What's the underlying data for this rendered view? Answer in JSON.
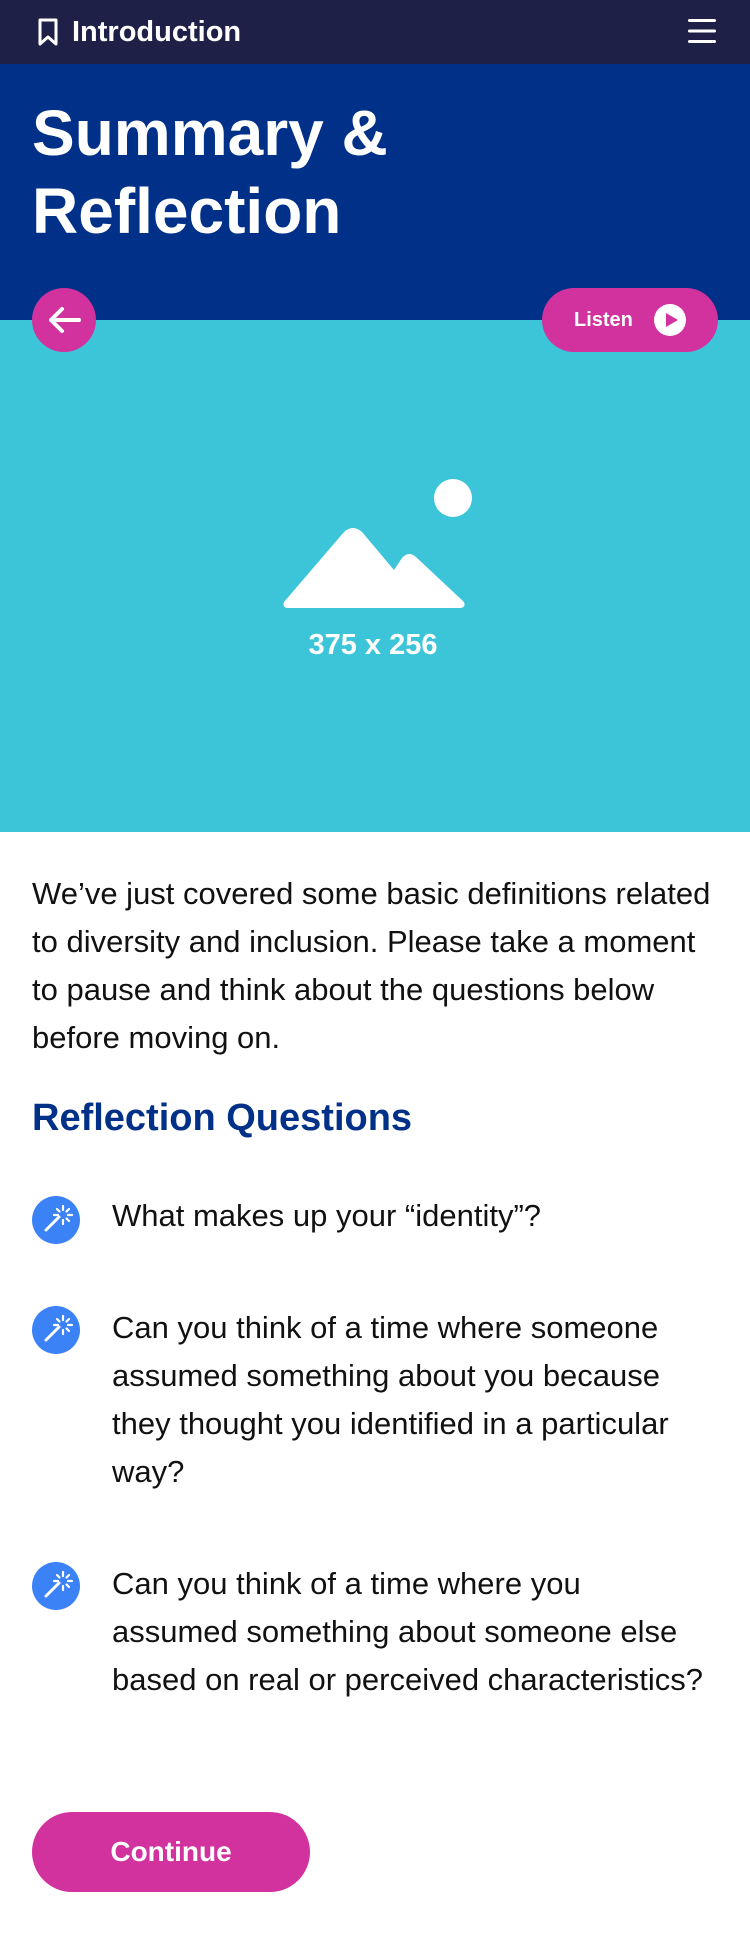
{
  "header": {
    "section_title": "Introduction",
    "bookmark_icon": "bookmark-icon",
    "menu_icon": "hamburger-menu-icon"
  },
  "hero": {
    "title": "Summary & Reflection"
  },
  "media": {
    "placeholder_label": "375 x 256",
    "placeholder_icon": "image-placeholder-icon"
  },
  "controls": {
    "back_icon": "arrow-left-icon",
    "listen_label": "Listen",
    "play_icon": "play-icon"
  },
  "content": {
    "intro": "We’ve just covered some basic definitions related to diversity and inclusion. Please take a moment to pause and think about the questions below before moving on.",
    "reflection_title": "Reflection Questions",
    "questions": [
      {
        "icon": "sparkle-wand-icon",
        "text": "What makes up your “identity”?"
      },
      {
        "icon": "sparkle-wand-icon",
        "text": "Can you think of a time where someone assumed something about you because they thought you identified in a particular way?"
      },
      {
        "icon": "sparkle-wand-icon",
        "text": "Can you think of a time where you assumed something about someone else based on real or perceived characteristics?"
      }
    ]
  },
  "footer": {
    "continue_label": "Continue"
  },
  "colors": {
    "topbar": "#1f2047",
    "hero": "#003087",
    "media": "#3cc5d9",
    "accent": "#d1329e",
    "heading": "#003087",
    "icon": "#3b82f6"
  }
}
